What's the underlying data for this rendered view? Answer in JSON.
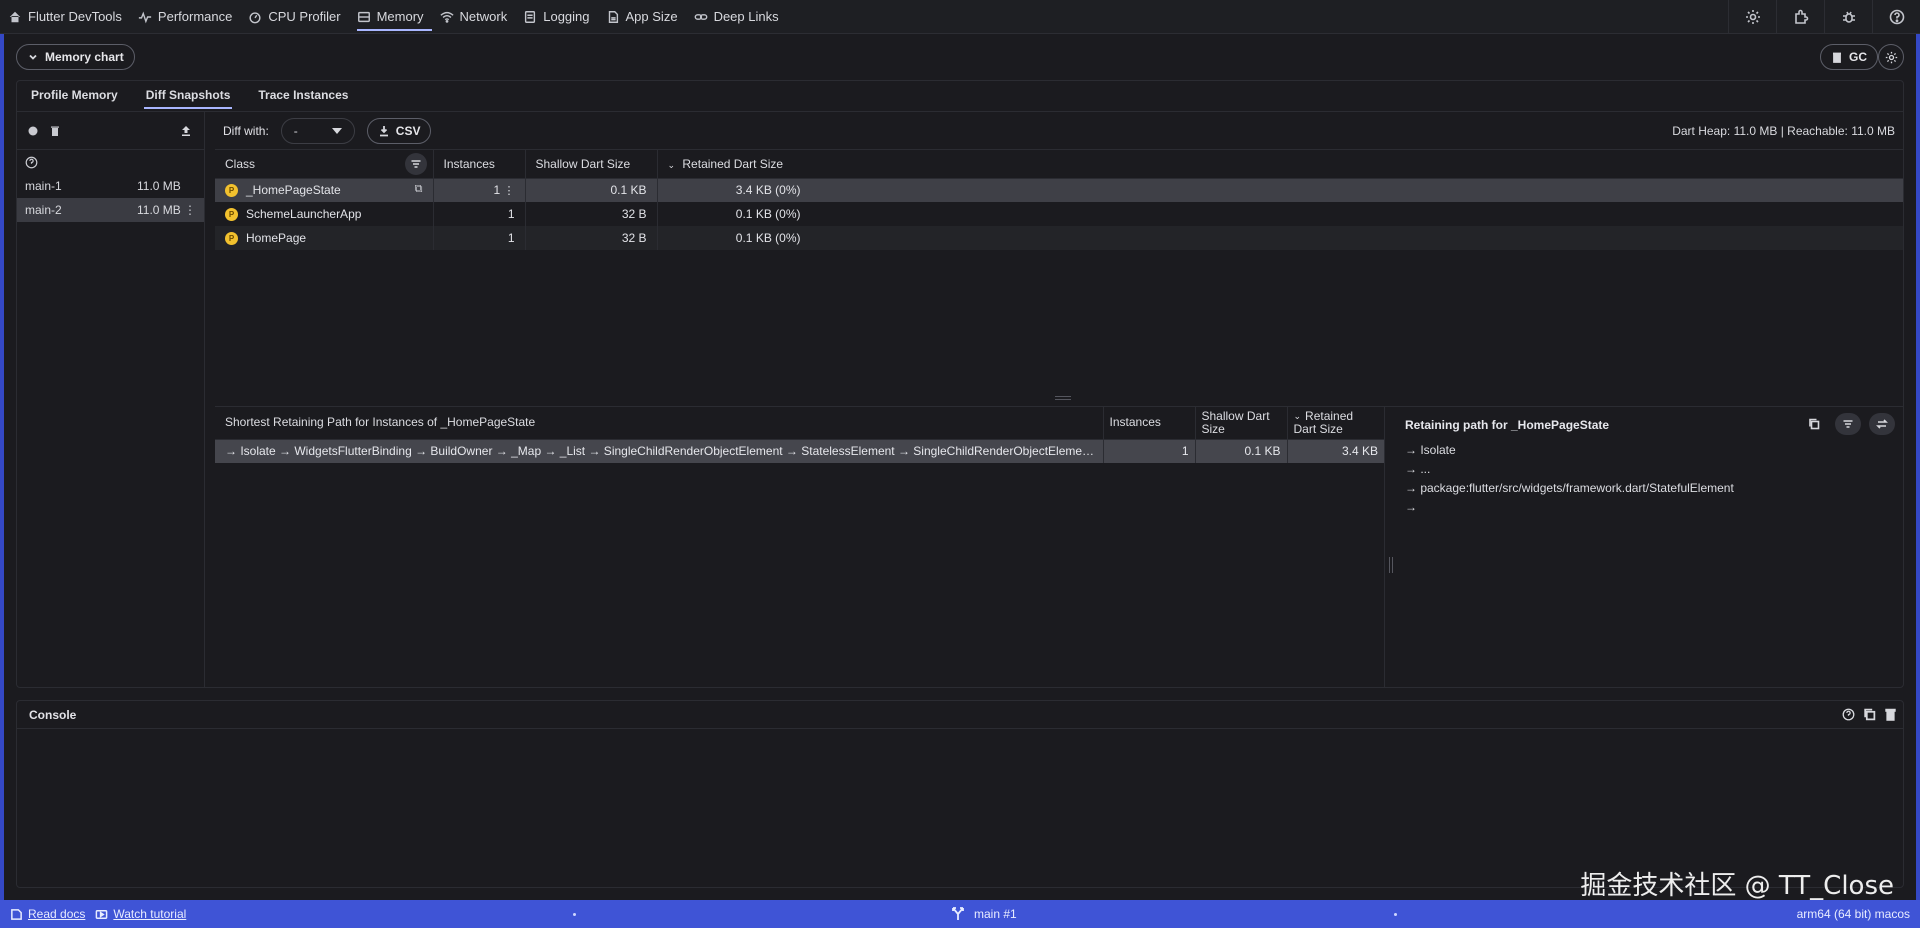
{
  "nav": {
    "tabs": [
      {
        "label": "Flutter DevTools",
        "icon": "home-icon"
      },
      {
        "label": "Performance",
        "icon": "pulse-icon"
      },
      {
        "label": "CPU Profiler",
        "icon": "timer-icon"
      },
      {
        "label": "Memory",
        "icon": "memory-icon"
      },
      {
        "label": "Network",
        "icon": "wifi-icon"
      },
      {
        "label": "Logging",
        "icon": "log-icon"
      },
      {
        "label": "App Size",
        "icon": "file-icon"
      },
      {
        "label": "Deep Links",
        "icon": "link-icon"
      }
    ],
    "active": "Memory",
    "actions": [
      "settings-icon",
      "extensions-icon",
      "bug-icon",
      "help-icon"
    ]
  },
  "memory_chart_button": "Memory chart",
  "gc_button": "GC",
  "subtabs": [
    "Profile Memory",
    "Diff Snapshots",
    "Trace Instances"
  ],
  "snapshots": [
    {
      "name": "main-1",
      "size": "11.0 MB"
    },
    {
      "name": "main-2",
      "size": "11.0 MB"
    }
  ],
  "diff": {
    "label": "Diff with:",
    "value": "-",
    "csv_label": "CSV",
    "heap_info": "Dart Heap: 11.0 MB | Reachable: 11.0 MB"
  },
  "class_table": {
    "headers": [
      "Class",
      "Instances",
      "Shallow Dart Size",
      "Retained Dart Size"
    ],
    "rows": [
      {
        "class": "_HomePageState",
        "instances": "1",
        "shallow": "0.1 KB",
        "retained": "3.4 KB (0%)"
      },
      {
        "class": "SchemeLauncherApp",
        "instances": "1",
        "shallow": "32 B",
        "retained": "0.1 KB (0%)"
      },
      {
        "class": "HomePage",
        "instances": "1",
        "shallow": "32 B",
        "retained": "0.1 KB (0%)"
      }
    ]
  },
  "path_table": {
    "headers": [
      "Shortest Retaining Path for Instances of _HomePageState",
      "Instances",
      "Shallow Dart Size",
      "Retained Dart Size"
    ],
    "row": {
      "path": "→ Isolate → WidgetsFlutterBinding → BuildOwner → _Map → _List → SingleChildRenderObjectElement → StatelessElement → SingleChildRenderObjectElement …",
      "instances": "1",
      "shallow": "0.1 KB",
      "retained": "3.4 KB"
    }
  },
  "retaining": {
    "title": "Retaining path for _HomePageState",
    "lines": [
      "→ Isolate",
      "→ ...",
      "→ package:flutter/src/widgets/framework.dart/StatefulElement",
      "→"
    ]
  },
  "console": {
    "title": "Console"
  },
  "status": {
    "read_docs": "Read docs",
    "watch_tutorial": "Watch tutorial",
    "isolate": "main #1",
    "platform": "arm64 (64 bit) macos"
  },
  "watermark": "掘金技术社区 @ TT_Close",
  "colors": {
    "accent": "#a9b6ff",
    "statusbar": "#3f54d6",
    "class_dot": "#f2c12e"
  }
}
